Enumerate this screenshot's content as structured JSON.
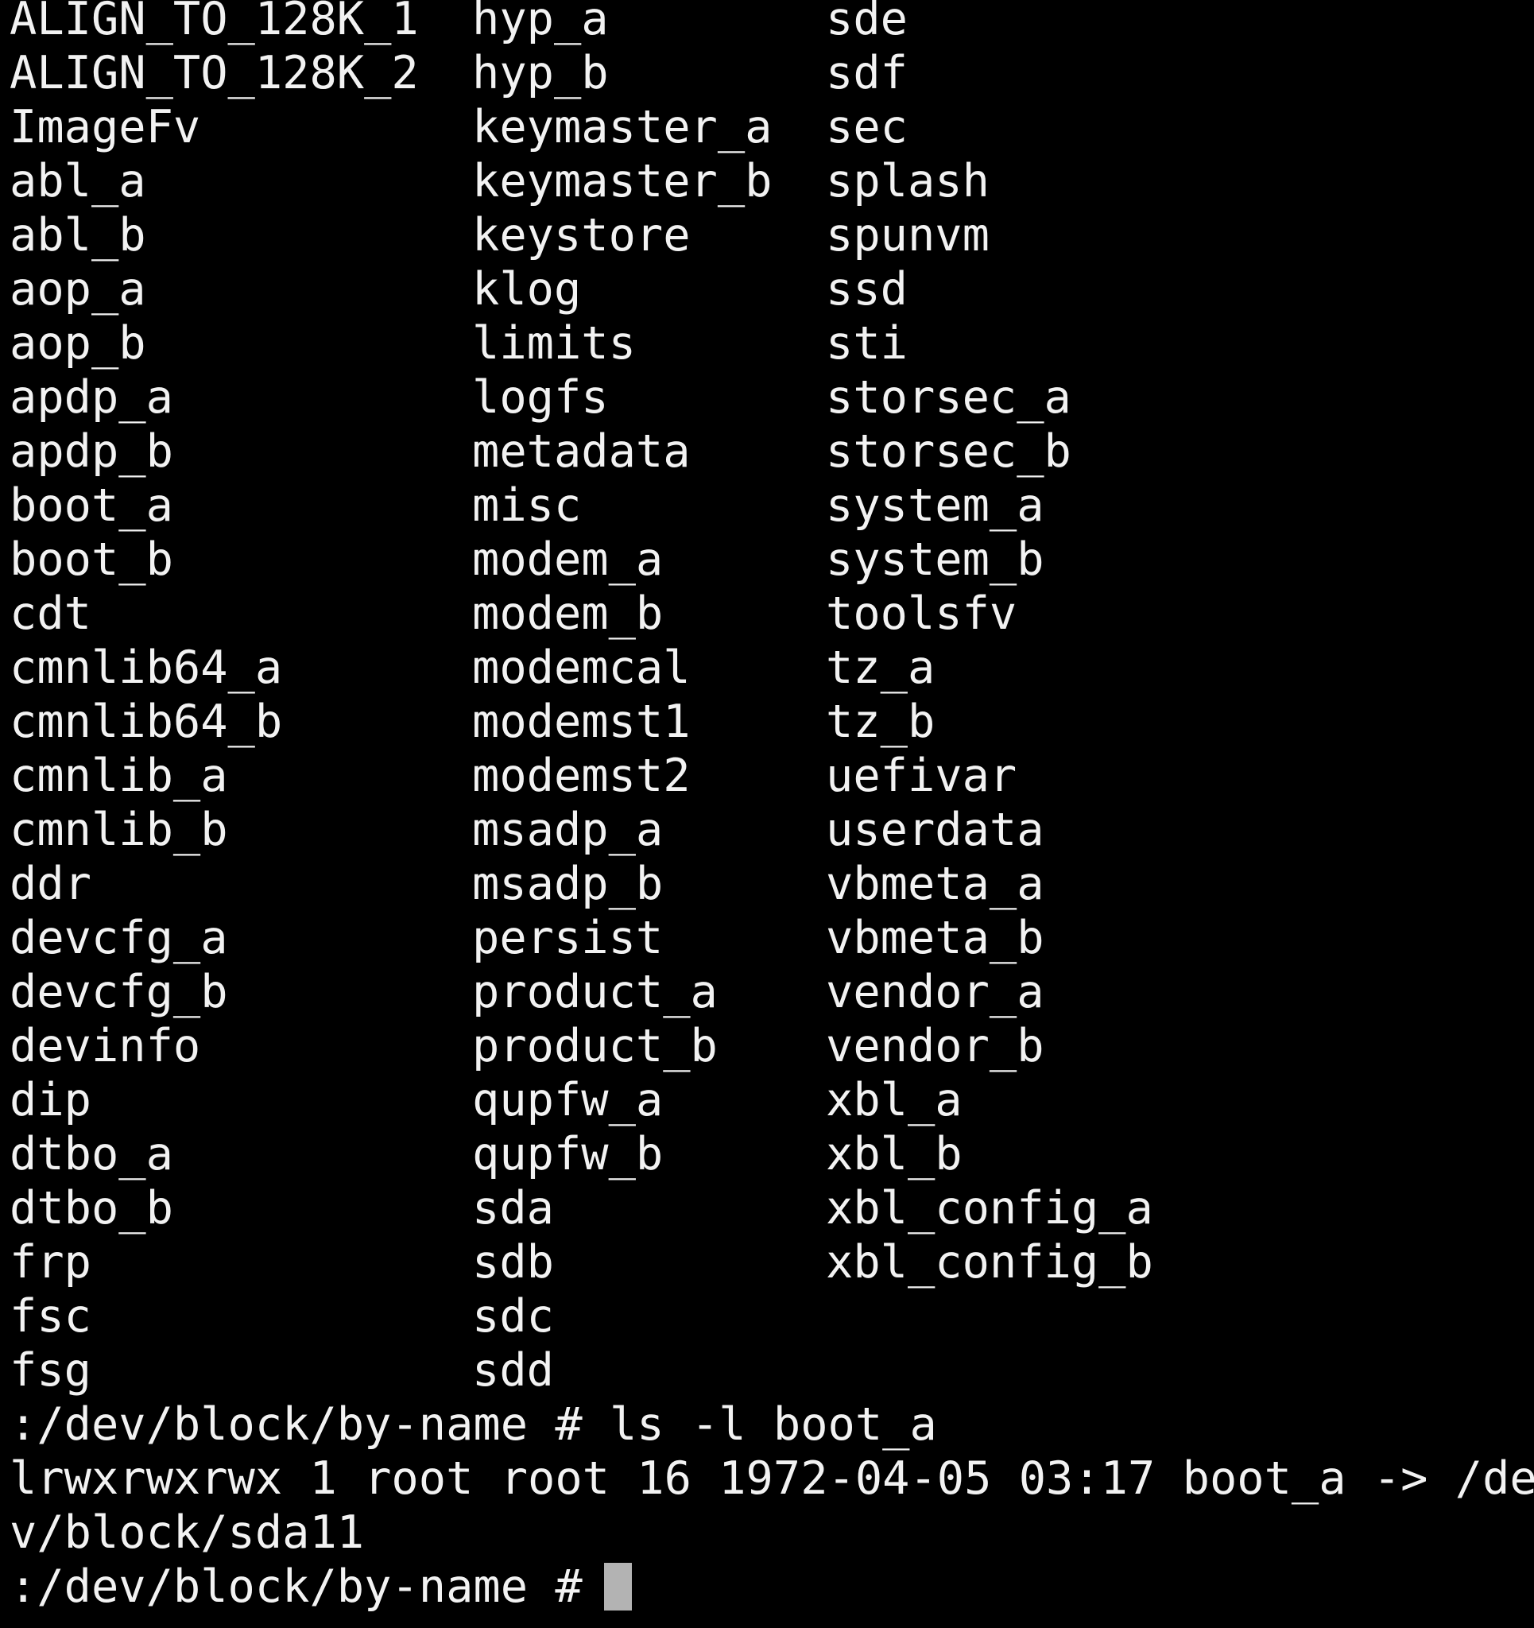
{
  "terminal": {
    "background_color": "#000000",
    "text_color": "#f2f2f2",
    "cursor_color": "#b3b3b3",
    "cursor_glyph": "block-cursor"
  },
  "listing": {
    "columns": 3,
    "rows": [
      [
        "ALIGN_TO_128K_1",
        "hyp_a",
        "sde"
      ],
      [
        "ALIGN_TO_128K_2",
        "hyp_b",
        "sdf"
      ],
      [
        "ImageFv",
        "keymaster_a",
        "sec"
      ],
      [
        "abl_a",
        "keymaster_b",
        "splash"
      ],
      [
        "abl_b",
        "keystore",
        "spunvm"
      ],
      [
        "aop_a",
        "klog",
        "ssd"
      ],
      [
        "aop_b",
        "limits",
        "sti"
      ],
      [
        "apdp_a",
        "logfs",
        "storsec_a"
      ],
      [
        "apdp_b",
        "metadata",
        "storsec_b"
      ],
      [
        "boot_a",
        "misc",
        "system_a"
      ],
      [
        "boot_b",
        "modem_a",
        "system_b"
      ],
      [
        "cdt",
        "modem_b",
        "toolsfv"
      ],
      [
        "cmnlib64_a",
        "modemcal",
        "tz_a"
      ],
      [
        "cmnlib64_b",
        "modemst1",
        "tz_b"
      ],
      [
        "cmnlib_a",
        "modemst2",
        "uefivar"
      ],
      [
        "cmnlib_b",
        "msadp_a",
        "userdata"
      ],
      [
        "ddr",
        "msadp_b",
        "vbmeta_a"
      ],
      [
        "devcfg_a",
        "persist",
        "vbmeta_b"
      ],
      [
        "devcfg_b",
        "product_a",
        "vendor_a"
      ],
      [
        "devinfo",
        "product_b",
        "vendor_b"
      ],
      [
        "dip",
        "qupfw_a",
        "xbl_a"
      ],
      [
        "dtbo_a",
        "qupfw_b",
        "xbl_b"
      ],
      [
        "dtbo_b",
        "sda",
        "xbl_config_a"
      ],
      [
        "frp",
        "sdb",
        "xbl_config_b"
      ],
      [
        "fsc",
        "sdc",
        ""
      ],
      [
        "fsg",
        "sdd",
        ""
      ]
    ]
  },
  "session": {
    "prompt_command_line": ":/dev/block/by-name # ls -l boot_a",
    "output_line_1": "lrwxrwxrwx 1 root root 16 1972-04-05 03:17 boot_a -> /de",
    "output_line_2": "v/block/sda11",
    "prompt_current": ":/dev/block/by-name # "
  }
}
